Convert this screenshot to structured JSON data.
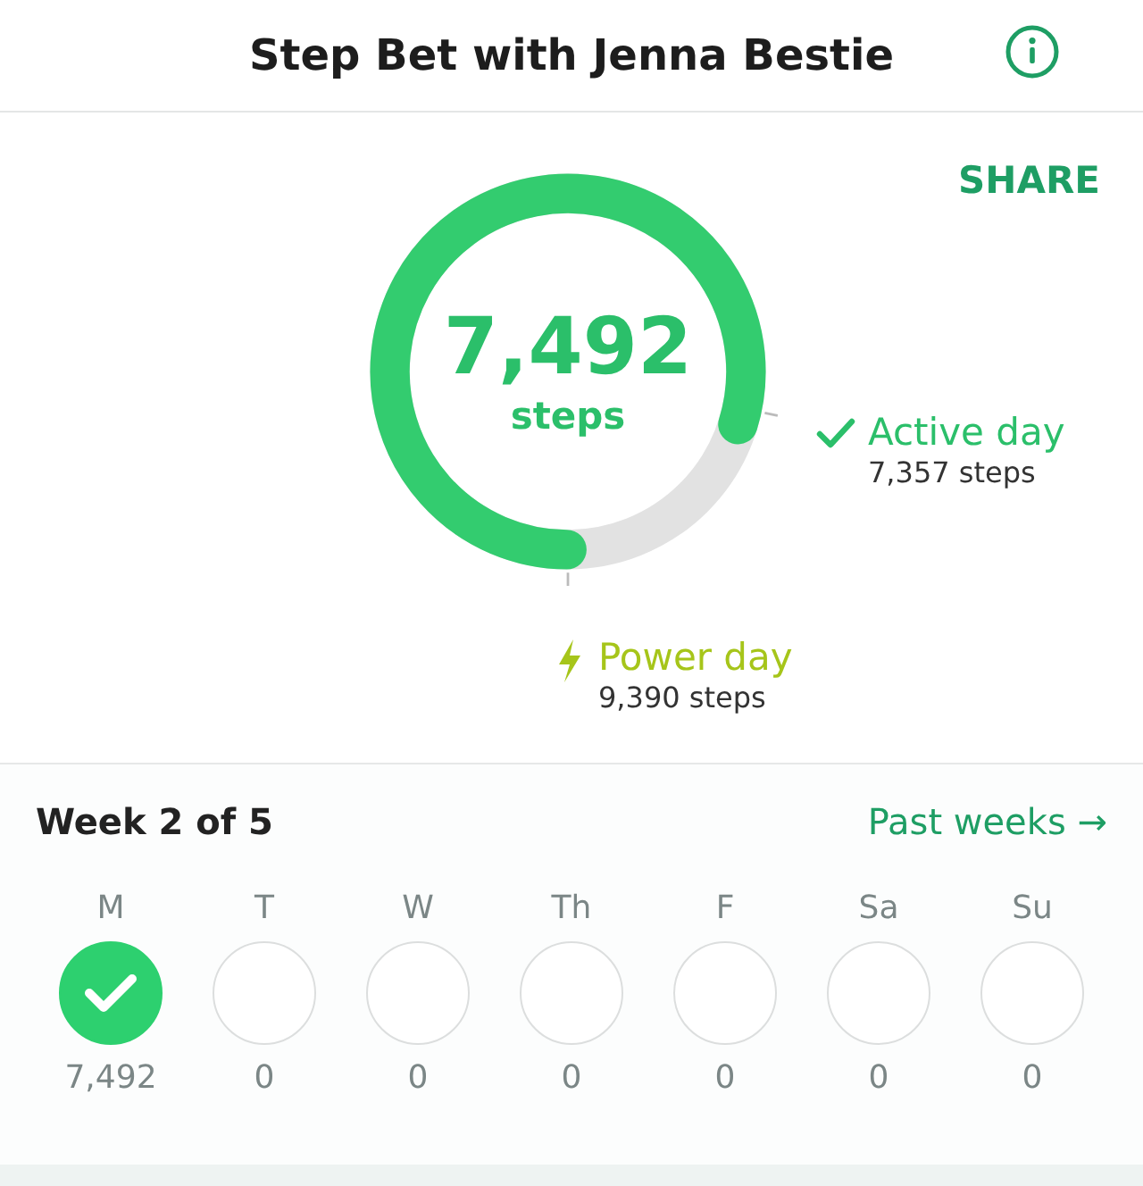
{
  "header": {
    "title": "Step Bet with Jenna Bestie"
  },
  "share": "SHARE",
  "ring": {
    "value": "7,492",
    "unit": "steps"
  },
  "targets": [
    {
      "kind": "active",
      "label": "Active day",
      "steps": "7,357 steps"
    },
    {
      "kind": "power",
      "label": "Power day",
      "steps": "9,390 steps"
    }
  ],
  "week": {
    "title": "Week 2 of 5",
    "link": "Past weeks",
    "link_arrow": "→"
  },
  "days": [
    {
      "label": "M",
      "completed": true,
      "steps": "7,492"
    },
    {
      "label": "T",
      "completed": false,
      "steps": "0"
    },
    {
      "label": "W",
      "completed": false,
      "steps": "0"
    },
    {
      "label": "Th",
      "completed": false,
      "steps": "0"
    },
    {
      "label": "F",
      "completed": false,
      "steps": "0"
    },
    {
      "label": "Sa",
      "completed": false,
      "steps": "0"
    },
    {
      "label": "Su",
      "completed": false,
      "steps": "0"
    }
  ]
}
